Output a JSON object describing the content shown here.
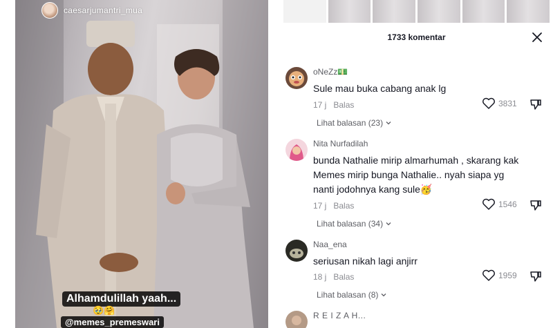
{
  "video": {
    "uploader_handle": "caesarjumantri_mua",
    "caption_line1": "Alhamdulillah yaah...",
    "caption_emojis": "🥹🤗",
    "caption_line2": "@memes_premeswari"
  },
  "comments_panel": {
    "title": "1733 komentar",
    "close_icon": "close-icon",
    "comments": [
      {
        "username": "oNeZz💵",
        "text": "Sule mau buka cabang anak lg",
        "time": "17 j",
        "reply_label": "Balas",
        "likes": "3831",
        "view_replies": "Lihat balasan (23)"
      },
      {
        "username": "Nita Nurfadilah",
        "text": "bunda Nathalie mirip almarhumah , skarang kak Memes mirip bunga Nathalie.. nyah siapa yg nanti jodohnya kang sule🥳",
        "time": "17 j",
        "reply_label": "Balas",
        "likes": "1546",
        "view_replies": "Lihat balasan (34)"
      },
      {
        "username": "Naa_ena",
        "text": "seriusan nikah lagi anjirr",
        "time": "18 j",
        "reply_label": "Balas",
        "likes": "1959",
        "view_replies": "Lihat balasan (8)"
      },
      {
        "username": "R E I Z A H..."
      }
    ]
  },
  "colors": {
    "text_primary": "#161823",
    "text_secondary": "#8a8b91",
    "caption_bg": "#000000"
  }
}
